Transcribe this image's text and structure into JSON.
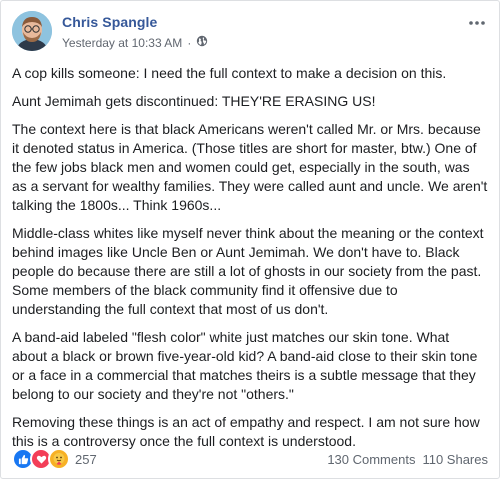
{
  "post": {
    "author": "Chris Spangle",
    "timestamp": "Yesterday at 10:33 AM",
    "audience_icon": "globe-icon",
    "paragraphs": [
      "A cop kills someone: I need the full context to make a decision on this.",
      "Aunt Jemimah gets discontinued: THEY'RE ERASING US!",
      "The context here is that black Americans weren't called Mr. or Mrs. because it denoted status in America. (Those titles are short for master, btw.) One of the few jobs black men and women could get, especially in the south, was as a servant for wealthy families. They were called aunt and uncle. We aren't talking the 1800s... Think 1960s...",
      "Middle-class whites like myself never think about the meaning or the context behind images like Uncle Ben or Aunt Jemimah. We don't have to. Black people do because there are still a lot of ghosts in our society from the past. Some members of the black community find it offensive due to understanding the full context that most of us don't.",
      "A band-aid labeled \"flesh color\" white just matches our skin tone. What about a black or brown five-year-old kid? A band-aid close to their skin tone or a face in a commercial that matches theirs is a subtle message that they belong to our society and they're not \"others.\"",
      "Removing these things is an act of empathy and respect. I am not sure how this is a controversy once the full context is understood."
    ]
  },
  "footer": {
    "reaction_count": "257",
    "comments": "130 Comments",
    "shares": "110 Shares"
  },
  "colors": {
    "author_link": "#365899",
    "like": "#1877f2",
    "love": "#f33e58",
    "care": "#f7b125"
  }
}
